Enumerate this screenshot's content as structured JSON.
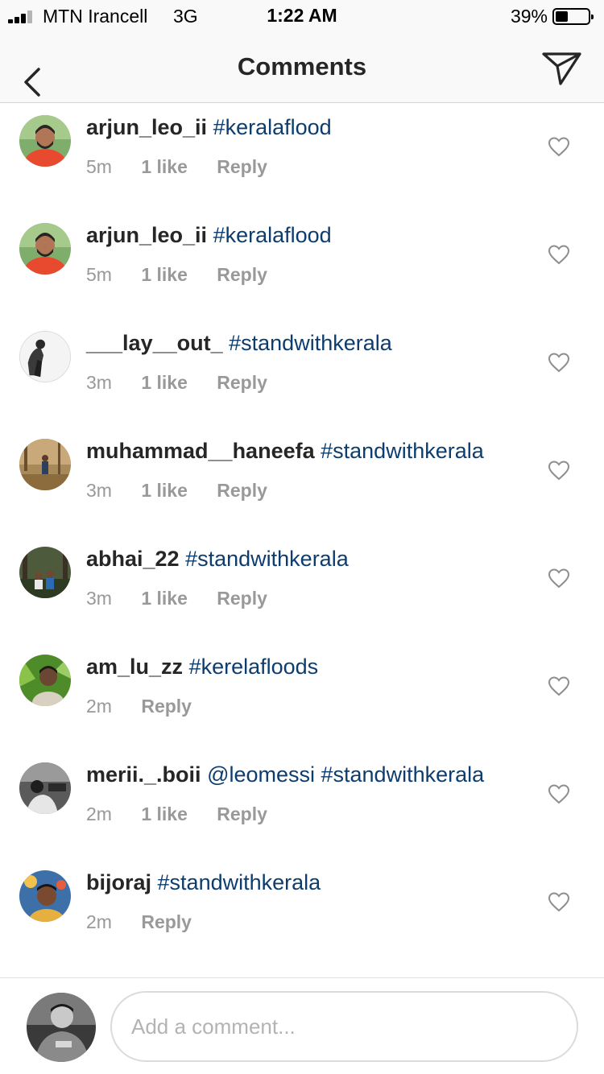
{
  "status_bar": {
    "carrier": "MTN Irancell",
    "network": "3G",
    "time": "1:22 AM",
    "battery_percent": "39%",
    "battery_level": 0.39,
    "signal_bars": 3
  },
  "nav": {
    "title": "Comments",
    "back_icon": "chevron-left-icon",
    "share_icon": "paper-plane-icon"
  },
  "comments": [
    {
      "username": "arjun_leo_ii",
      "text": "#keralaflood",
      "time": "5m",
      "likes": "1 like",
      "reply": "Reply"
    },
    {
      "username": "arjun_leo_ii",
      "text": "#keralaflood",
      "time": "5m",
      "likes": "1 like",
      "reply": "Reply"
    },
    {
      "username": "___lay__out_",
      "text": "#standwithkerala",
      "time": "3m",
      "likes": "1 like",
      "reply": "Reply"
    },
    {
      "username": "muhammad__haneefa",
      "text": "#standwithkerala",
      "time": "3m",
      "likes": "1 like",
      "reply": "Reply"
    },
    {
      "username": "abhai_22",
      "text": "#standwithkerala",
      "time": "3m",
      "likes": "1 like",
      "reply": "Reply"
    },
    {
      "username": "am_lu_zz",
      "text": "#kerelafloods",
      "time": "2m",
      "likes": "",
      "reply": "Reply"
    },
    {
      "username": "merii._.boii",
      "text": "@leomessi #standwithkerala",
      "time": "2m",
      "likes": "1 like",
      "reply": "Reply"
    },
    {
      "username": "bijoraj",
      "text": "#standwithkerala",
      "time": "2m",
      "likes": "",
      "reply": "Reply"
    }
  ],
  "composer": {
    "placeholder": "Add a comment..."
  },
  "colors": {
    "hashtag": "#0c3d6e",
    "meta": "#999999",
    "bar_background": "#f9f9f9"
  }
}
